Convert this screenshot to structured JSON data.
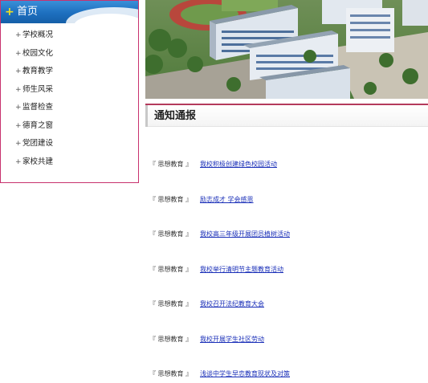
{
  "sidebar": {
    "home_label": "首页",
    "items": [
      {
        "label": "学校概况"
      },
      {
        "label": "校园文化"
      },
      {
        "label": "教育教学"
      },
      {
        "label": "师生风采"
      },
      {
        "label": "监督检查"
      },
      {
        "label": "德育之窗"
      },
      {
        "label": "党团建设"
      },
      {
        "label": "家校共建"
      }
    ]
  },
  "banner": {
    "image": "campus-aerial-photo"
  },
  "notices": {
    "title": "通知通报",
    "items": [
      {
        "category": "『 思想教育 』",
        "title": "我校积极创建绿色校园活动"
      },
      {
        "category": "『 思想教育 』",
        "title": "励志成才 学会感恩"
      },
      {
        "category": "『 思想教育 』",
        "title": "我校高三年级开展团员植树活动"
      },
      {
        "category": "『 思想教育 』",
        "title": "我校举行清明节主题教育活动"
      },
      {
        "category": "『 思想教育 』",
        "title": "我校召开法纪教育大会"
      },
      {
        "category": "『 思想教育 』",
        "title": "我校开展学生社区劳动"
      },
      {
        "category": "『 思想教育 』",
        "title": "浅谈中学生早恋教育现状及对策"
      }
    ]
  },
  "colors": {
    "border_accent": "#c8326e",
    "link": "#1a2fb8",
    "header_blue": "#1d6fbf"
  }
}
